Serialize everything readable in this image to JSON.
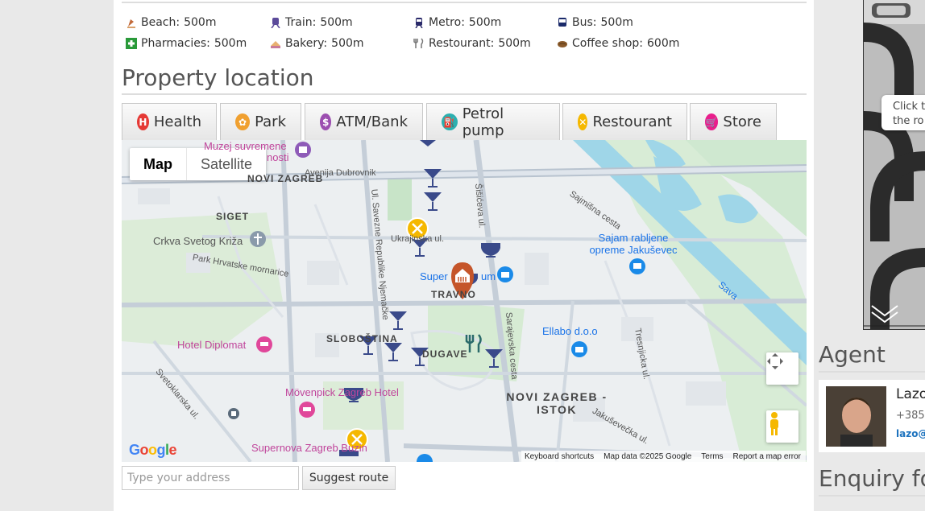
{
  "distances": [
    {
      "icon": "beach-icon",
      "label": "Beach:",
      "value": "500m"
    },
    {
      "icon": "train-icon",
      "label": "Train:",
      "value": "500m"
    },
    {
      "icon": "metro-icon",
      "label": "Metro:",
      "value": "500m"
    },
    {
      "icon": "bus-icon",
      "label": "Bus:",
      "value": "500m"
    },
    {
      "icon": "pharmacy-icon",
      "label": "Pharmacies:",
      "value": "500m"
    },
    {
      "icon": "bakery-icon",
      "label": "Bakery:",
      "value": "500m"
    },
    {
      "icon": "restaurant-icon",
      "label": "Restourant:",
      "value": "500m"
    },
    {
      "icon": "coffee-icon",
      "label": "Coffee shop:",
      "value": "600m"
    }
  ],
  "section_title": "Property location",
  "poi_tabs": [
    {
      "label": "Health",
      "icon": "health-icon",
      "color": "#e53935",
      "glyph": "H"
    },
    {
      "label": "Park",
      "icon": "park-icon",
      "color": "#f0a030",
      "glyph": "✿"
    },
    {
      "label": "ATM/Bank",
      "icon": "bank-icon",
      "color": "#9c4fb0",
      "glyph": "$"
    },
    {
      "label": "Petrol pump",
      "icon": "petrol-icon",
      "color": "#2bb0b0",
      "glyph": "⛽"
    },
    {
      "label": "Restourant",
      "icon": "restaurant-icon",
      "color": "#f5b800",
      "glyph": "✕"
    },
    {
      "label": "Store",
      "icon": "store-icon",
      "color": "#e91e8c",
      "glyph": "🛒"
    }
  ],
  "map": {
    "type_map": "Map",
    "type_satellite": "Satellite",
    "labels": {
      "muzej": "Muzej suvremene",
      "umjetnosti": "nosti",
      "novi_zagreb": "NOVI ZAGREB",
      "avenija": "Avenija Dubrovnik",
      "siget": "SIGET",
      "crkva": "Crkva Svetog Križa",
      "park_hrv": "Park Hrvatske mornarice",
      "ukrajinska": "Ukrajinska ul.",
      "super": "Super",
      "super2": "um",
      "travno": "TRAVNO",
      "sajam": "Sajam rabljene opreme Jakuševec",
      "sajmisna": "Sajmišna cesta",
      "sava": "Sava",
      "ellabo": "Ellabo d.o.o",
      "hotel_diplomat": "Hotel Diplomat",
      "slobostina": "SLOBOŠTINA",
      "dugave": "DUGAVE",
      "movenpick": "Mövenpick Zagreb Hotel",
      "supernova": "Supernova Zagreb Buzin",
      "novi_zagreb_istok": "NOVI ZAGREB - ISTOK",
      "jakusevecka": "Jakuševečka ul.",
      "sarajevska": "Sarajevska cesta",
      "savezne": "Ul. Savezne Republike Njemačke",
      "sisicev": "Šišićeva ul.",
      "svetoklarska": "Svetoklarska ul.",
      "tresnjicka": "Tresnjicka ul."
    },
    "google_logo": "Google",
    "attribution": {
      "shortcuts": "Keyboard shortcuts",
      "data": "Map data ©2025 Google",
      "terms": "Terms",
      "report": "Report a map error"
    }
  },
  "address_placeholder": "Type your address",
  "suggest_route": "Suggest route",
  "side_tip": {
    "line1": "Click to",
    "line2": "the ro"
  },
  "agent": {
    "title": "Agent",
    "name": "Lazo",
    "phone": "+385",
    "email": "lazo@"
  },
  "enquiry_title": "Enquiry fo"
}
